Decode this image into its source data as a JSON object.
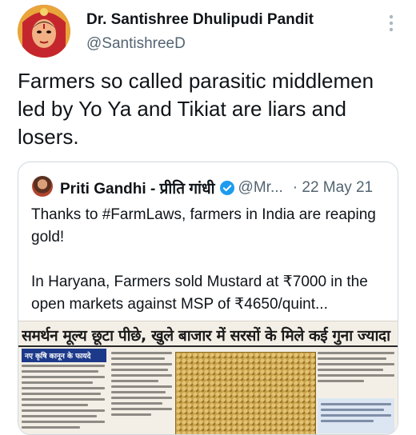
{
  "author": {
    "display_name": "Dr. Santishree Dhulipudi Pandit",
    "handle": "@SantishreeD"
  },
  "tweet": {
    "text": "Farmers so called parasitic middlemen led by Yo Ya and Tikiat are liars and losers."
  },
  "quoted_tweet": {
    "display_name": "Priti Gandhi - प्रीति गांधी",
    "handle": "@Mr...",
    "date": "· 22 May 21",
    "paragraph_1": "Thanks to #FarmLaws, farmers in India are reaping gold!",
    "paragraph_2": "In Haryana, Farmers sold Mustard at ₹7000 in the open markets against MSP of ₹4650/quint...",
    "image": {
      "headline": "समर्थन मूल्य छूटा पीछे, खुले बाजार में सरसों के मिले कई गुना ज्यादा दाम",
      "column_tag": "नए कृषि कानून के फायदे"
    }
  },
  "icons": {
    "more": "more-vertical-icon",
    "verified": "verified-badge-icon"
  },
  "colors": {
    "text_primary": "#0f1419",
    "text_secondary": "#536471",
    "verified_blue": "#1d9bf0",
    "border": "#cfd9de"
  }
}
